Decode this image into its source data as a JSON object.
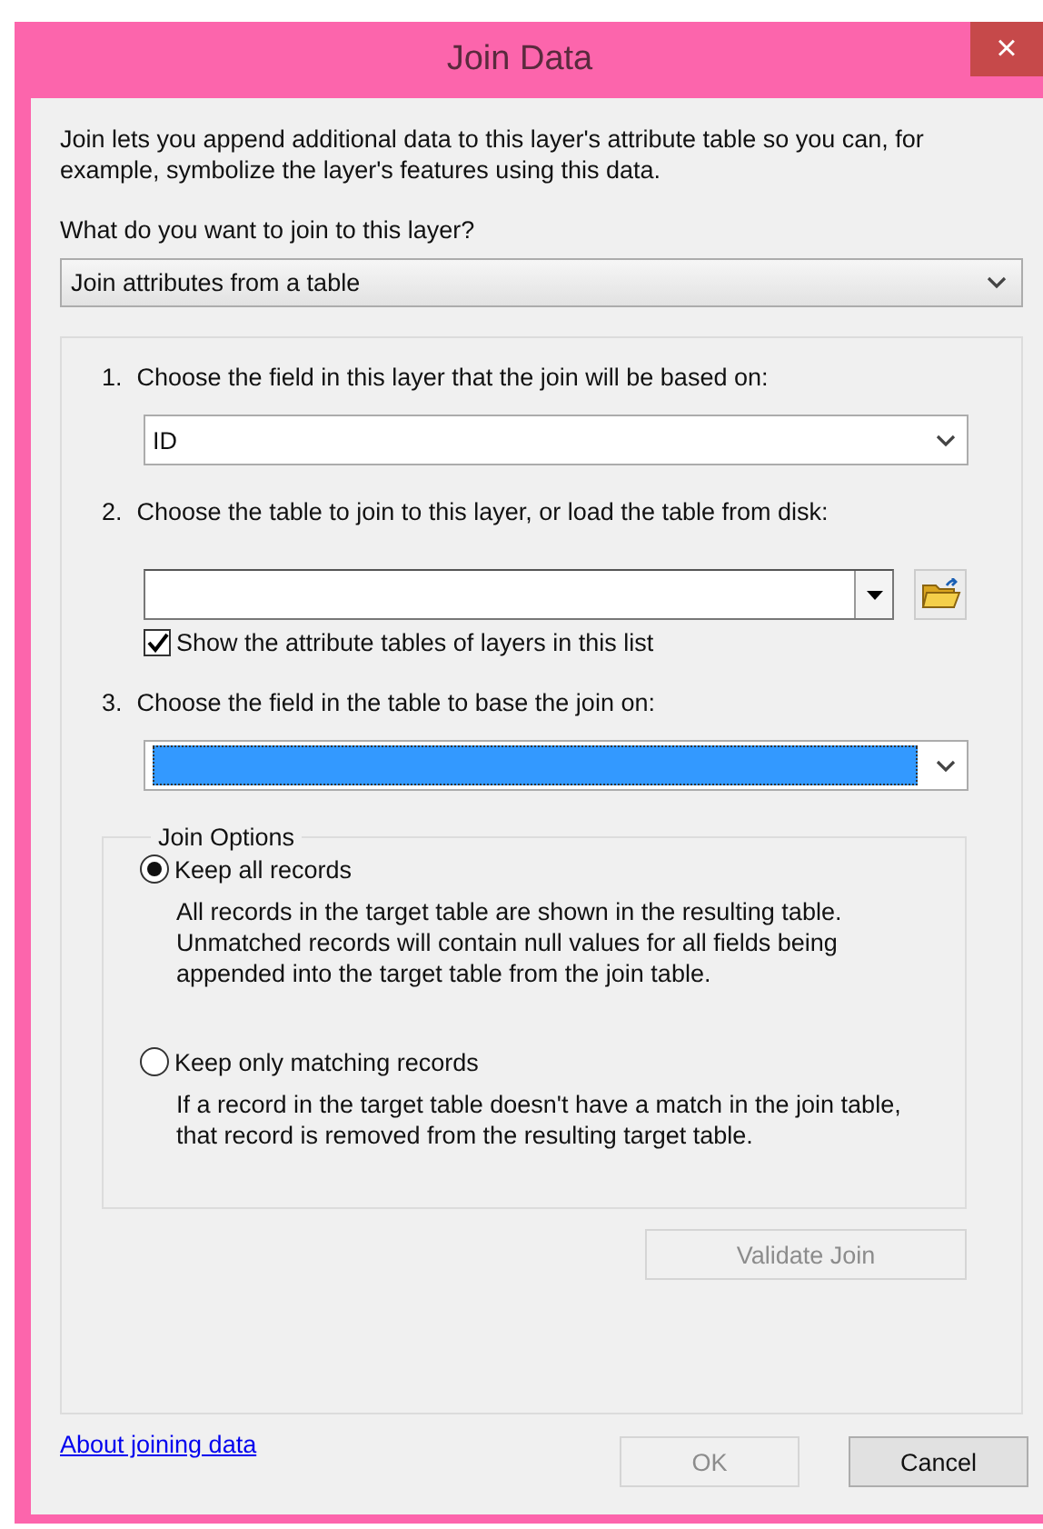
{
  "window": {
    "title": "Join Data",
    "close": "×"
  },
  "intro": "Join lets you append additional data to this layer's attribute table so you can, for example, symbolize the layer's features using this data.",
  "question": "What do you want to join to this layer?",
  "join_type": {
    "value": "Join attributes from a table"
  },
  "steps": [
    {
      "kind": "dropdown",
      "number": "1.",
      "label": "Choose the field in this layer that the join will be based on:",
      "value": "ID",
      "highlighted": false
    },
    {
      "kind": "combo",
      "number": "2.",
      "label": "Choose the table to join to this layer, or load the table from disk:",
      "checkbox": {
        "label": "Show the attribute tables of layers in this list",
        "checked": true
      }
    },
    {
      "kind": "dropdown",
      "number": "3.",
      "label": "Choose the field in the table to base the join on:",
      "highlighted": true
    }
  ],
  "join_options": {
    "legend": "Join Options",
    "options": [
      {
        "label": "Keep all records",
        "selected": true,
        "description": "All records in the target table are shown in the resulting table. Unmatched records will contain null values for all fields being appended into the target table from the join table."
      },
      {
        "label": "Keep only matching records",
        "selected": false,
        "description": "If a record in the target table doesn't have a match in the join table, that record is removed from the resulting target table."
      }
    ]
  },
  "validate_button": {
    "label": "Validate Join",
    "disabled": true
  },
  "help_link": "About joining data",
  "buttons": [
    {
      "label": "OK",
      "disabled": true
    },
    {
      "label": "Cancel",
      "disabled": false
    }
  ]
}
